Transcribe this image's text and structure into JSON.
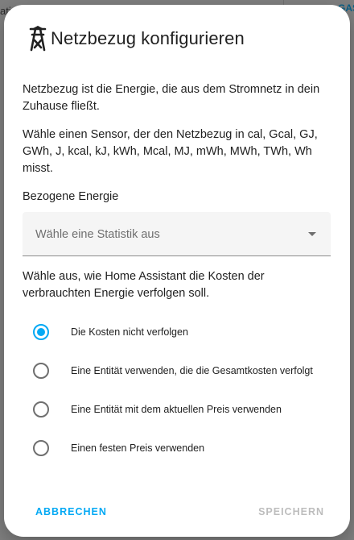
{
  "background": {
    "fragment_left": "ati",
    "fragment_right": "GAS"
  },
  "dialog": {
    "title": "Netzbezug konfigurieren",
    "title_icon": "transmission-tower-icon",
    "intro": "Netzbezug ist die Energie, die aus dem Stromnetz in dein Zuhause fließt.",
    "sensor_hint": "Wähle einen Sensor, der den Netzbezug in cal, Gcal, GJ, GWh, J, kcal, kJ, kWh, Mcal, MJ, mWh, MWh, TWh, Wh misst.",
    "field_label": "Bezogene Energie",
    "select_placeholder": "Wähle eine Statistik aus",
    "cost_hint": "Wähle aus, wie Home Assistant die Kosten der verbrauchten Energie verfolgen soll.",
    "cost_options": [
      {
        "label": "Die Kosten nicht verfolgen",
        "checked": true
      },
      {
        "label": "Eine Entität verwenden, die die Gesamtkosten verfolgt",
        "checked": false
      },
      {
        "label": "Eine Entität mit dem aktuellen Preis verwenden",
        "checked": false
      },
      {
        "label": "Einen festen Preis verwenden",
        "checked": false
      }
    ],
    "cancel_label": "ABBRECHEN",
    "save_label": "SPEICHERN"
  },
  "colors": {
    "accent": "#03a9f4",
    "disabled": "#bdbdbd",
    "scrim": "#7f7f7f"
  }
}
